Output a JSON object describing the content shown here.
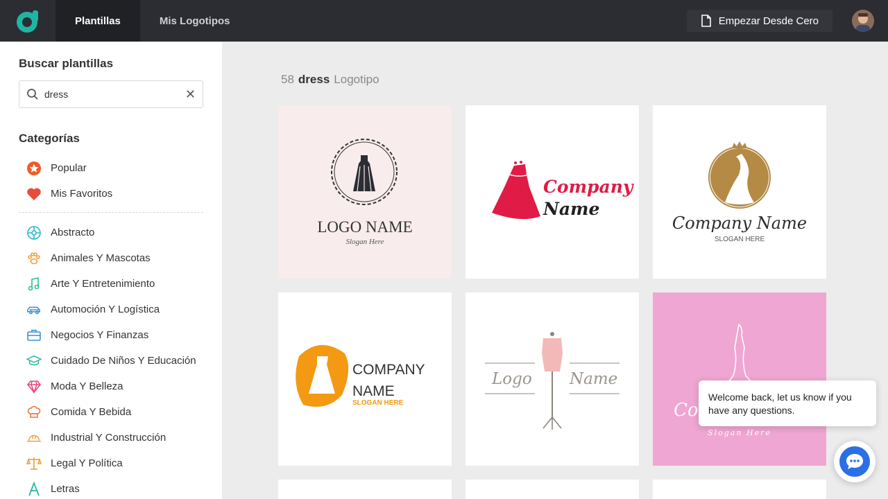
{
  "topbar": {
    "tabs": [
      {
        "label": "Plantillas",
        "active": true
      },
      {
        "label": "Mis Logotipos",
        "active": false
      }
    ],
    "start_button": "Empezar Desde Cero",
    "accent": "#1fb5a3"
  },
  "sidebar": {
    "search_heading": "Buscar plantillas",
    "search_value": "dress",
    "categories_heading": "Categorías",
    "top_items": [
      {
        "label": "Popular",
        "icon": "star-badge-icon",
        "color": "#f05a28"
      },
      {
        "label": "Mis Favoritos",
        "icon": "heart-icon",
        "color": "#e74c3c"
      }
    ],
    "items": [
      {
        "label": "Abstracto",
        "icon": "abstract-swirl-icon",
        "color": "#2bb7c7"
      },
      {
        "label": "Animales Y Mascotas",
        "icon": "paw-icon",
        "color": "#f0a03c"
      },
      {
        "label": "Arte Y Entretenimiento",
        "icon": "music-note-icon",
        "color": "#2bc08f"
      },
      {
        "label": "Automoción Y Logística",
        "icon": "car-icon",
        "color": "#3a8fd6"
      },
      {
        "label": "Negocios Y Finanzas",
        "icon": "briefcase-icon",
        "color": "#3a8fd6"
      },
      {
        "label": "Cuidado De Niños Y Educación",
        "icon": "graduation-cap-icon",
        "color": "#2bb7a0"
      },
      {
        "label": "Moda Y Belleza",
        "icon": "diamond-icon",
        "color": "#e8477c"
      },
      {
        "label": "Comida Y Bebida",
        "icon": "chef-hat-icon",
        "color": "#f07a3c"
      },
      {
        "label": "Industrial Y Construcción",
        "icon": "hard-hat-icon",
        "color": "#f0a03c"
      },
      {
        "label": "Legal Y Política",
        "icon": "scales-icon",
        "color": "#e8a23c"
      },
      {
        "label": "Letras",
        "icon": "letter-a-icon",
        "color": "#2bb7a0"
      }
    ]
  },
  "results": {
    "count": "58",
    "query": "dress",
    "kind": "Logotipo"
  },
  "templates": [
    {
      "line1": "LOGO NAME",
      "line2": "Slogan Here",
      "bg": "#f8ecec"
    },
    {
      "line1": "Company",
      "line2": "Name",
      "bg": "#ffffff"
    },
    {
      "line1": "Company Name",
      "line2": "SLOGAN HERE",
      "bg": "#ffffff"
    },
    {
      "line1": "COMPANY",
      "line2": "NAME",
      "line3": "SLOGAN HERE",
      "bg": "#ffffff"
    },
    {
      "line1": "Logo",
      "line2": "Name",
      "bg": "#ffffff"
    },
    {
      "line1": "Co",
      "line2": "Slogan Here",
      "bg": "#efa6d2"
    }
  ],
  "chat": {
    "message": "Welcome back, let us know if you have any questions."
  }
}
